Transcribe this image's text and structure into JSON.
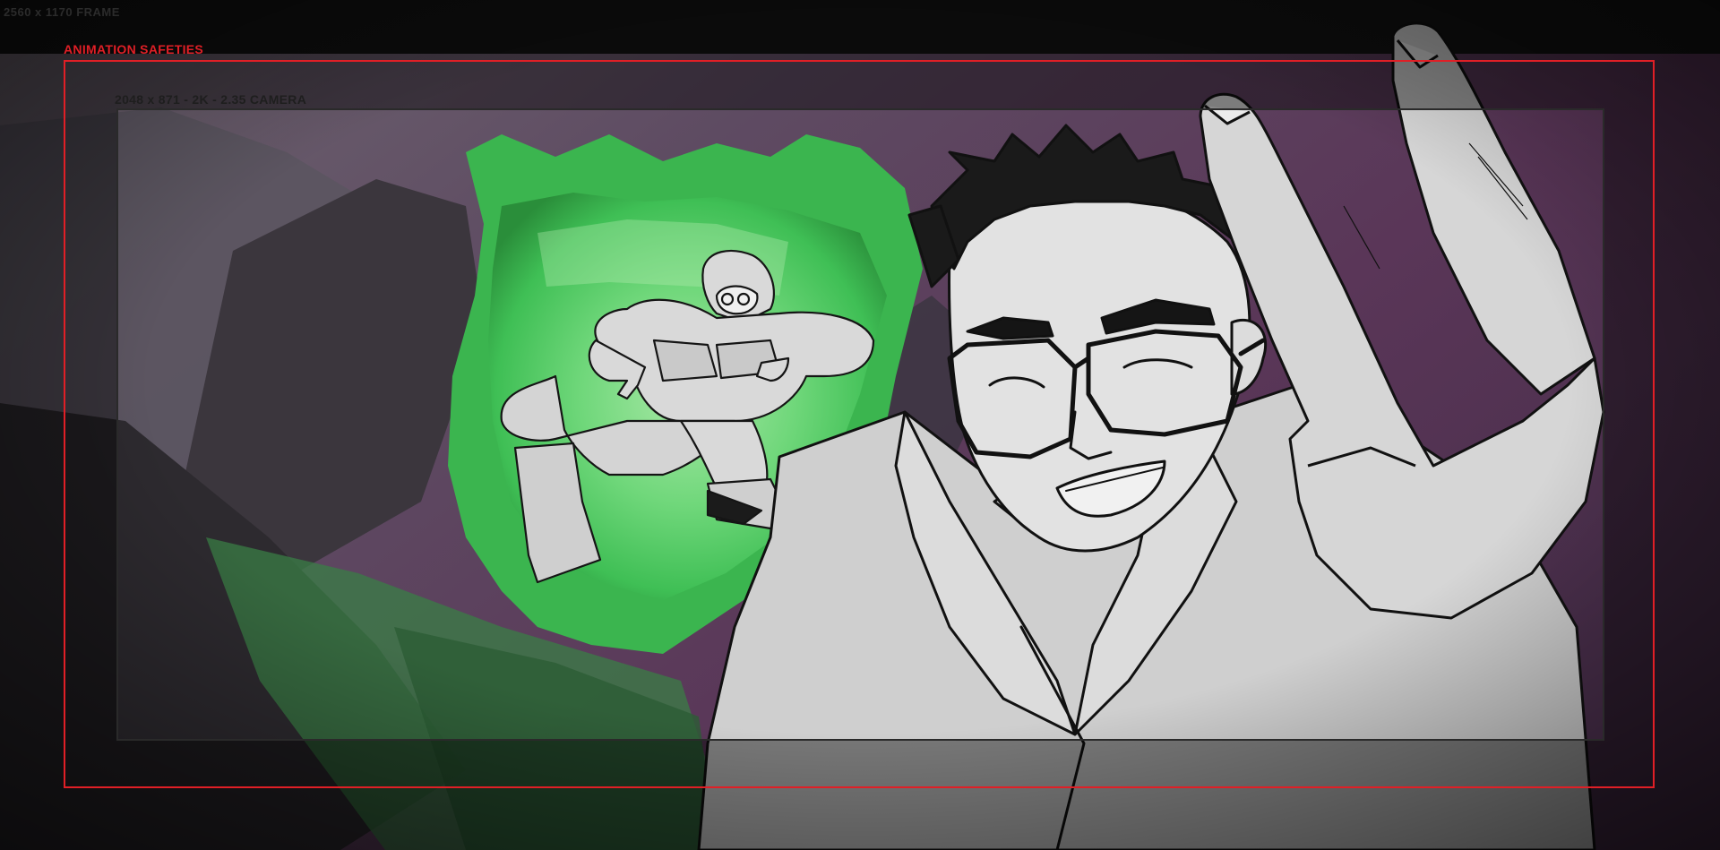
{
  "overlay": {
    "frame_label": "2560 x 1170 FRAME",
    "safeties_label": "ANIMATION SAFETIES",
    "camera_label": "2048 x 871 - 2K - 2.35 CAMERA"
  },
  "colors": {
    "safeties_red": "#e01f26",
    "background": "#141414",
    "glow_green": "#4fd66a",
    "sky_purple": "#5c3a5e"
  }
}
